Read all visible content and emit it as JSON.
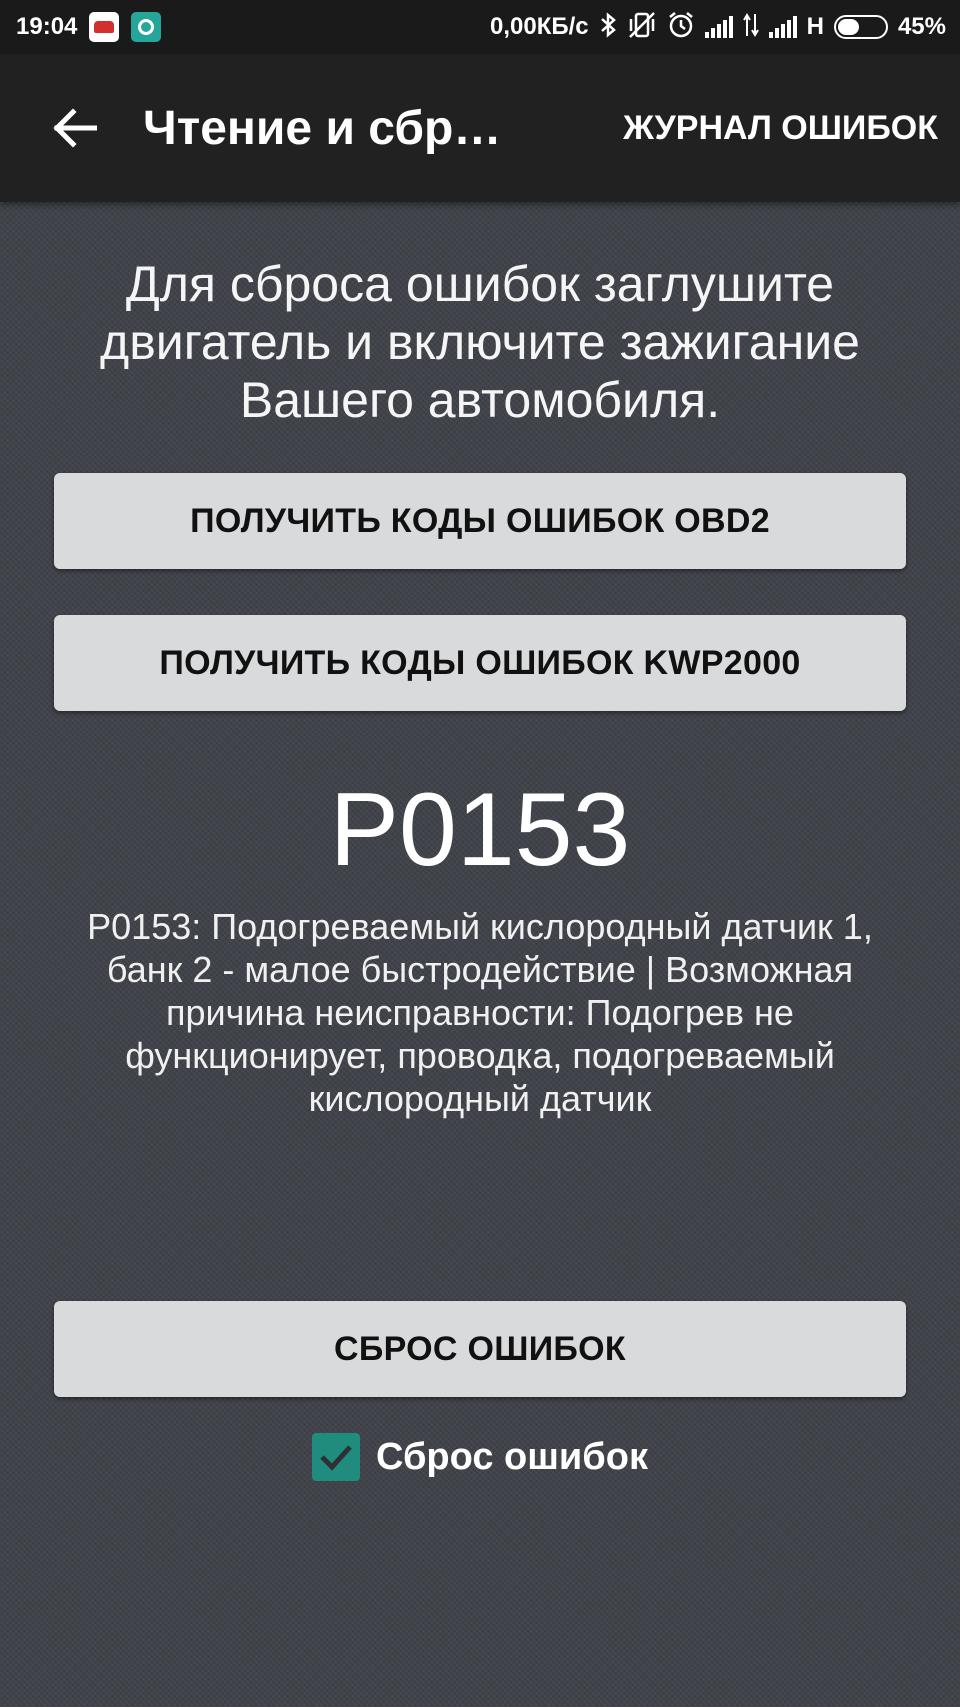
{
  "status_bar": {
    "time": "19:04",
    "network_speed": "0,00КБ/с",
    "network_type": "H",
    "battery_percent": "45%",
    "battery_level": 0.45,
    "icons": [
      "car-app-icon",
      "ring-app-icon",
      "bluetooth-icon",
      "vibrate-off-icon",
      "alarm-icon",
      "signal-icon",
      "data-transfer-icon",
      "signal-icon",
      "battery-icon"
    ]
  },
  "app_bar": {
    "title": "Чтение и сбр…",
    "action_label": "ЖУРНАЛ ОШИБОК",
    "back_icon": "arrow-left-icon"
  },
  "main": {
    "instruction": "Для сброса ошибок заглушите двигатель и включите зажигание Вашего автомобиля.",
    "obd2_button": "ПОЛУЧИТЬ КОДЫ ОШИБОК OBD2",
    "kwp_button": "ПОЛУЧИТЬ КОДЫ ОШИБОК KWP2000",
    "error_code": "P0153",
    "error_description": "P0153: Подогреваемый кислородный датчик 1, банк 2 - малое быстродействие | Возможная причина неисправности: Подогрев не функционирует, проводка, подогреваемый кислородный датчик",
    "reset_button": "СБРОС ОШИБОК",
    "reset_checkbox": {
      "label": "Сброс ошибок",
      "checked": true
    }
  },
  "colors": {
    "background": "#3e4248",
    "app_bar": "#212121",
    "status_bar": "#1a1a1a",
    "button": "#d9dadb",
    "checkbox_accent": "#1f8c7d"
  }
}
